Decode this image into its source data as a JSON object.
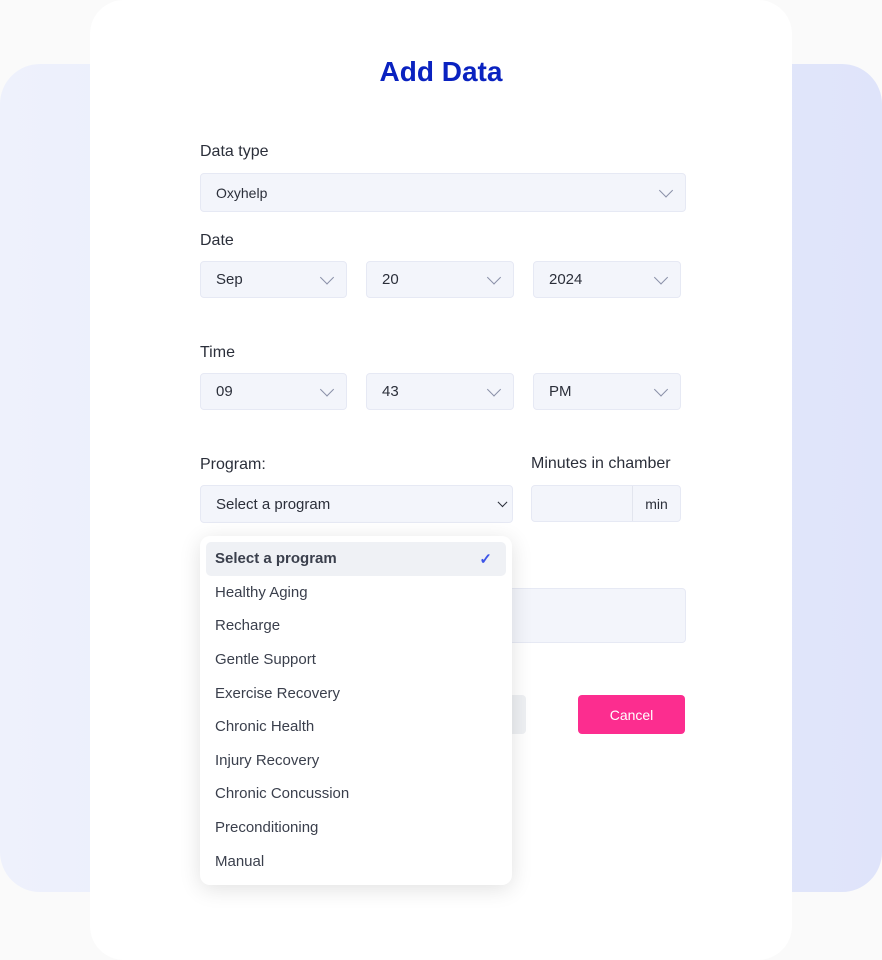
{
  "title": "Add Data",
  "data_type": {
    "label": "Data type",
    "value": "Oxyhelp"
  },
  "date": {
    "label": "Date",
    "month": "Sep",
    "day": "20",
    "year": "2024"
  },
  "time": {
    "label": "Time",
    "hour": "09",
    "minute": "43",
    "ampm": "PM"
  },
  "program": {
    "label": "Program:",
    "value": "Select a program",
    "options": [
      "Select a program",
      "Healthy Aging",
      "Recharge",
      "Gentle Support",
      "Exercise Recovery",
      "Chronic Health",
      "Injury Recovery",
      "Chronic Concussion",
      "Preconditioning",
      "Manual"
    ],
    "selected_index": 0
  },
  "minutes": {
    "label": "Minutes in chamber",
    "value": "",
    "unit": "min"
  },
  "buttons": {
    "cancel": "Cancel"
  },
  "colors": {
    "title": "#0a22c0",
    "cancel": "#fc2d8f",
    "check": "#3d55e8"
  }
}
